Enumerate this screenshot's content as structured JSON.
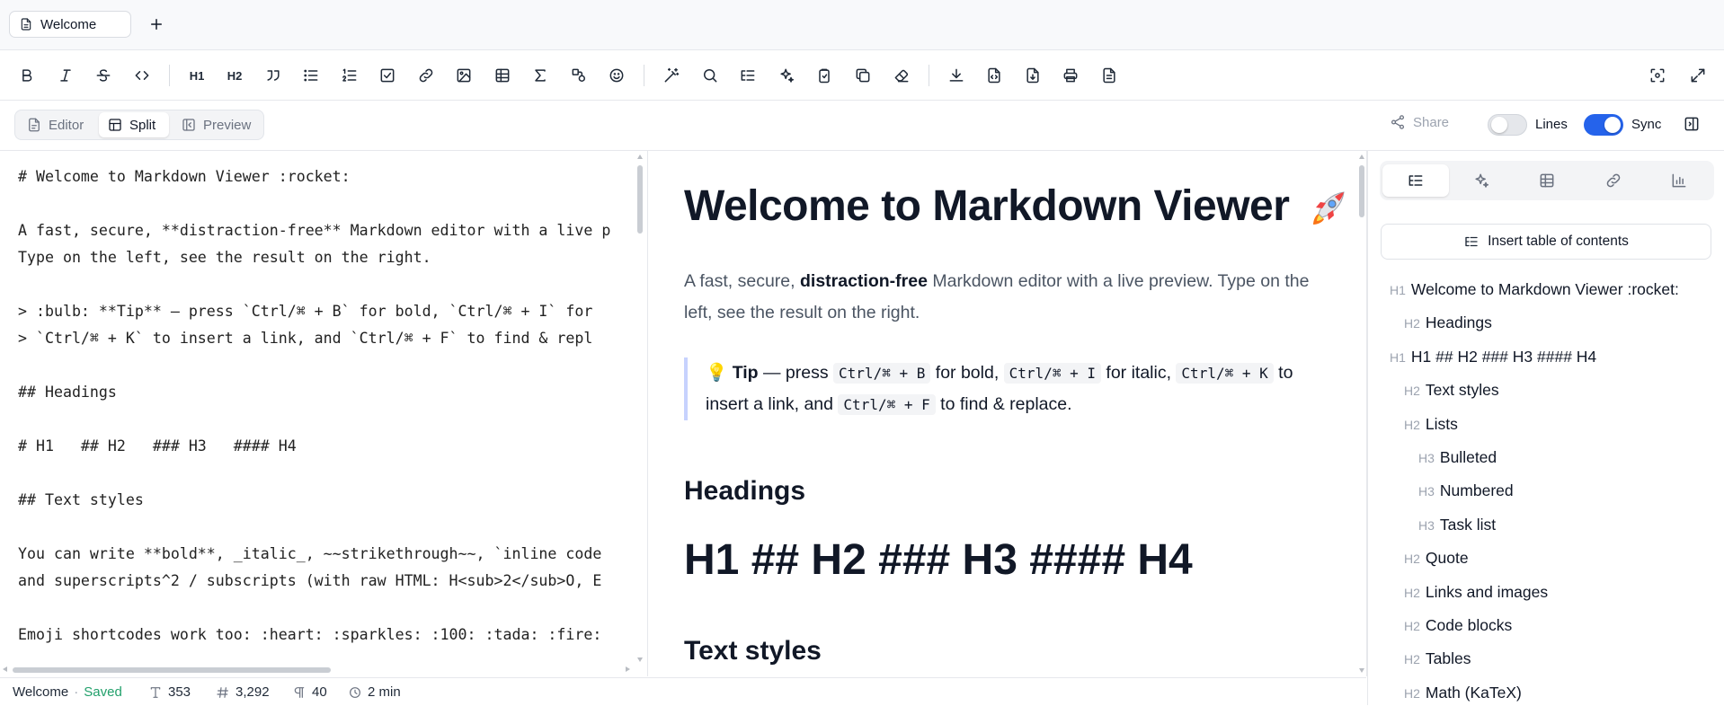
{
  "tabs": {
    "active_label": "Welcome"
  },
  "mode": {
    "editor": "Editor",
    "split": "Split",
    "preview": "Preview"
  },
  "header_right": {
    "share": "Share",
    "lines": "Lines",
    "sync": "Sync"
  },
  "toolbar": {
    "h1": "H1",
    "h2": "H2"
  },
  "editor": {
    "lines": [
      "# Welcome to Markdown Viewer :rocket:",
      "",
      "A fast, secure, **distraction-free** Markdown editor with a live p",
      "Type on the left, see the result on the right.",
      "",
      "> :bulb: **Tip** — press `Ctrl/⌘ + B` for bold, `Ctrl/⌘ + I` for",
      "> `Ctrl/⌘ + K` to insert a link, and `Ctrl/⌘ + F` to find & repl",
      "",
      "## Headings",
      "",
      "# H1   ## H2   ### H3   #### H4",
      "",
      "## Text styles",
      "",
      "You can write **bold**, _italic_, ~~strikethrough~~, `inline code",
      "and superscripts^2 / subscripts (with raw HTML: H<sub>2</sub>O, E",
      "",
      "Emoji shortcodes work too: :heart: :sparkles: :100: :tada: :fire:"
    ]
  },
  "preview": {
    "h1": "Welcome to Markdown Viewer",
    "intro_1": "A fast, secure, ",
    "intro_bold": "distraction-free",
    "intro_2": " Markdown editor with a live preview. Type on the left, see the result on the right.",
    "tip_bold": "Tip",
    "tip_dash": " — press ",
    "kbd_bold": "Ctrl/⌘ + B",
    "tip_for_bold": " for bold, ",
    "kbd_italic": "Ctrl/⌘ + I",
    "tip_for_italic": " for italic, ",
    "kbd_link": "Ctrl/⌘ + K",
    "tip_link": " to insert a link, and ",
    "kbd_find": "Ctrl/⌘ + F",
    "tip_find": " to find & replace.",
    "h2_headings": "Headings",
    "h1_levels": "H1 ## H2 ### H3 #### H4",
    "h2_text_styles": "Text styles"
  },
  "side_panel": {
    "insert_toc": "Insert table of contents",
    "toc": [
      {
        "level": "H1",
        "text": "Welcome to Markdown Viewer :rocket:"
      },
      {
        "level": "H2",
        "text": "Headings"
      },
      {
        "level": "H1",
        "text": "H1 ## H2 ### H3 #### H4"
      },
      {
        "level": "H2",
        "text": "Text styles"
      },
      {
        "level": "H2",
        "text": "Lists"
      },
      {
        "level": "H3",
        "text": "Bulleted"
      },
      {
        "level": "H3",
        "text": "Numbered"
      },
      {
        "level": "H3",
        "text": "Task list"
      },
      {
        "level": "H2",
        "text": "Quote"
      },
      {
        "level": "H2",
        "text": "Links and images"
      },
      {
        "level": "H2",
        "text": "Code blocks"
      },
      {
        "level": "H2",
        "text": "Tables"
      },
      {
        "level": "H2",
        "text": "Math (KaTeX)"
      }
    ]
  },
  "status": {
    "doc_name": "Welcome",
    "sep": "·",
    "saved": "Saved",
    "words": "353",
    "chars": "3,292",
    "paragraphs": "40",
    "read_time": "2 min"
  },
  "colors": {
    "accent": "#2563eb",
    "saved": "#22a06b",
    "quote_border": "#c7d2fe"
  }
}
